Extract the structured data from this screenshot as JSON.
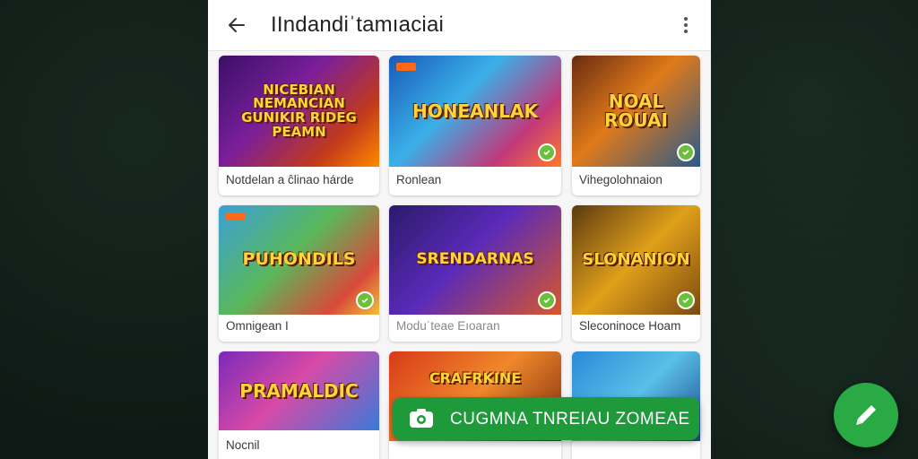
{
  "app_bar": {
    "title": "IIndandiˈtamıaciai",
    "back_icon": "arrow-left-icon",
    "menu_icon": "more-vertical-icon"
  },
  "cards": [
    {
      "label": "Notdelan a ĉlinao hárde",
      "thumb_text": "NICEBIAN NEMANCIAN GUNIKIR RIDEG PEAMN"
    },
    {
      "label": "Ronlean",
      "thumb_text": "HONEANLAK"
    },
    {
      "label": "Vihegolohnaion",
      "thumb_text": "NOAL ROUAI"
    },
    {
      "label": "Omnigean I",
      "thumb_text": "PUHONDILS"
    },
    {
      "label": "Moduˈteae Eıoaran",
      "thumb_text": "SRENDARNAS"
    },
    {
      "label": "Sleconinoce Hoam",
      "thumb_text": "SLONANION"
    },
    {
      "label": "Nocnil",
      "thumb_text": "PRAMALDIC"
    },
    {
      "label": "",
      "thumb_text": "CRAFRKINE"
    },
    {
      "label": "",
      "thumb_text": ""
    }
  ],
  "snackbar": {
    "text": "CUGMNA TNREIAU ZOMEAE",
    "icon": "camera-icon"
  },
  "fab": {
    "icon": "pencil-icon"
  },
  "colors": {
    "accent_green": "#2aaa44",
    "snackbar_green": "#1e9a3a",
    "background": "#0f1a16"
  }
}
